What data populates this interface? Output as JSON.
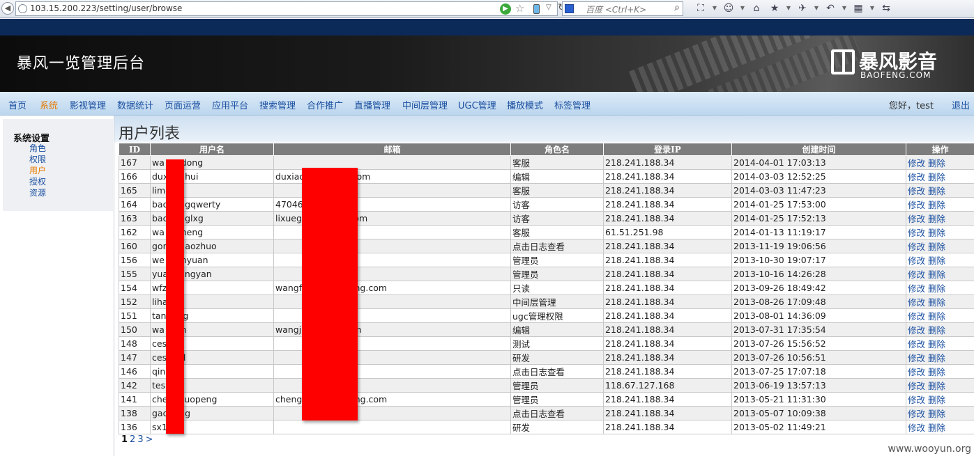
{
  "browser": {
    "url": "103.15.200.223/setting/user/browse",
    "search_placeholder": "百度 <Ctrl+K>"
  },
  "header": {
    "title": "暴风一览管理后台",
    "brand_cn": "暴风影音",
    "brand_en": "BAOFENG.COM"
  },
  "nav": {
    "items": [
      {
        "label": "首页",
        "active": false
      },
      {
        "label": "系统",
        "active": true
      },
      {
        "label": "影视管理",
        "active": false
      },
      {
        "label": "数据统计",
        "active": false
      },
      {
        "label": "页面运营",
        "active": false
      },
      {
        "label": "应用平台",
        "active": false
      },
      {
        "label": "搜索管理",
        "active": false
      },
      {
        "label": "合作推广",
        "active": false
      },
      {
        "label": "直播管理",
        "active": false
      },
      {
        "label": "中间层管理",
        "active": false
      },
      {
        "label": "UGC管理",
        "active": false
      },
      {
        "label": "播放模式",
        "active": false
      },
      {
        "label": "标签管理",
        "active": false
      }
    ],
    "greeting": "您好，test",
    "logout": "退出"
  },
  "sidebar": {
    "title": "系统设置",
    "items": [
      {
        "label": "角色",
        "active": false
      },
      {
        "label": "权限",
        "active": false
      },
      {
        "label": "用户",
        "active": true
      },
      {
        "label": "授权",
        "active": false
      },
      {
        "label": "资源",
        "active": false
      }
    ]
  },
  "main": {
    "title": "用户列表",
    "columns": [
      "ID",
      "用户名",
      "邮箱",
      "角色名",
      "登录IP",
      "创建时间",
      "操作"
    ],
    "edit_label": "修改",
    "delete_label": "删除",
    "rows": [
      [
        "167",
        "wa      dong",
        "",
        "客服",
        "218.241.188.34",
        "2014-04-01 17:03:13"
      ],
      [
        "166",
        "dux      hui",
        "duxiao              g.com",
        "编辑",
        "218.241.188.34",
        "2014-03-03 12:52:25"
      ],
      [
        "165",
        "limi",
        "",
        "客服",
        "218.241.188.34",
        "2014-03-03 11:47:23"
      ],
      [
        "164",
        "bao      gqwerty",
        "47046              m",
        "访客",
        "218.241.188.34",
        "2014-01-25 17:53:00"
      ],
      [
        "163",
        "bao      glxg",
        "lixueg              g.com",
        "访客",
        "218.241.188.34",
        "2014-01-25 17:52:13"
      ],
      [
        "162",
        "wa      heng",
        "",
        "客服",
        "61.51.251.98",
        "2014-01-13 11:19:17"
      ],
      [
        "160",
        "gon      aozhuo",
        "",
        "点击日志查看",
        "218.241.188.34",
        "2013-11-19 19:06:56"
      ],
      [
        "156",
        "we      nyuan",
        "",
        "管理员",
        "218.241.188.34",
        "2013-10-30 19:07:17"
      ],
      [
        "155",
        "yua      ngyan",
        "",
        "管理员",
        "218.241.188.34",
        "2013-10-16 14:26:28"
      ],
      [
        "154",
        "wfz",
        "wangf              ofeng.com",
        "只读",
        "218.241.188.34",
        "2013-09-26 18:49:42"
      ],
      [
        "152",
        "liha",
        "",
        "中间层管理",
        "218.241.188.34",
        "2013-08-26 17:09:48"
      ],
      [
        "151",
        "tan      g",
        "",
        "ugc管理权限",
        "218.241.188.34",
        "2013-08-01 14:36:09"
      ],
      [
        "150",
        "wa      n",
        "wangj              .com",
        "编辑",
        "218.241.188.34",
        "2013-07-31 17:35:54"
      ],
      [
        "148",
        "ces",
        "",
        "测试",
        "218.241.188.34",
        "2013-07-26 15:56:52"
      ],
      [
        "147",
        "ces      l",
        "",
        "研发",
        "218.241.188.34",
        "2013-07-26 10:56:51"
      ],
      [
        "146",
        "qin",
        "",
        "点击日志查看",
        "218.241.188.34",
        "2013-07-25 17:07:18"
      ],
      [
        "142",
        "tes",
        "",
        "管理员",
        "118.67.127.168",
        "2013-06-19 13:57:13"
      ],
      [
        "141",
        "che      uopeng",
        "cheng              ofeng.com",
        "管理员",
        "218.241.188.34",
        "2013-05-21 11:31:30"
      ],
      [
        "138",
        "gao      g",
        "",
        "点击日志查看",
        "218.241.188.34",
        "2013-05-07 10:09:38"
      ],
      [
        "136",
        "sx1",
        "",
        "研发",
        "218.241.188.34",
        "2013-05-02 11:49:21"
      ]
    ],
    "pager": {
      "pages": [
        "1",
        "2",
        "3"
      ],
      "current": "1",
      "next": ">"
    }
  },
  "watermark": "www.wooyun.org",
  "colors": {
    "nav_link": "#1a4fa0",
    "active": "#e87a00",
    "table_header": "#7d7d7d",
    "redaction": "#ff0000"
  }
}
